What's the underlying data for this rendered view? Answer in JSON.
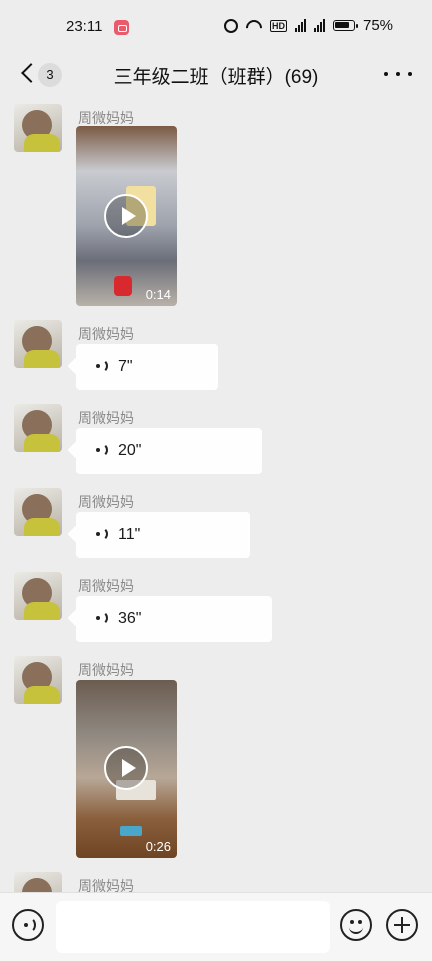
{
  "status_bar": {
    "time": "23:11",
    "battery": "75%"
  },
  "header": {
    "back_count": "3",
    "title": "三年级二班（班群）(69)"
  },
  "messages": [
    {
      "type": "video",
      "sender": "周微妈妈",
      "duration": "0:14"
    },
    {
      "type": "voice",
      "sender": "周微妈妈",
      "duration": "7\""
    },
    {
      "type": "voice",
      "sender": "周微妈妈",
      "duration": "20\""
    },
    {
      "type": "voice",
      "sender": "周微妈妈",
      "duration": "11\""
    },
    {
      "type": "voice",
      "sender": "周微妈妈",
      "duration": "36\""
    },
    {
      "type": "video",
      "sender": "周微妈妈",
      "duration": "0:26"
    },
    {
      "type": "partial",
      "sender": "周微妈妈"
    }
  ],
  "input": {
    "value": ""
  }
}
